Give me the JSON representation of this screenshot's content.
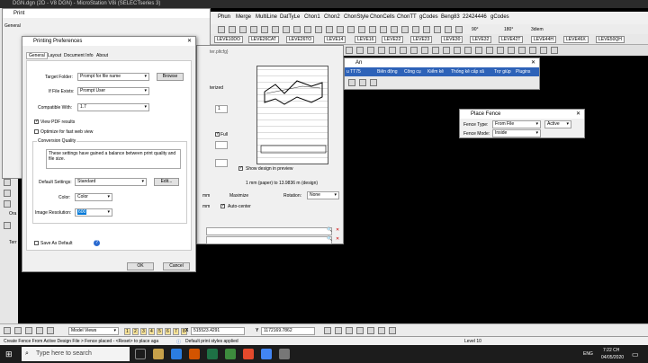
{
  "app": {
    "title": "DGN.dgn (2D - V8 DGN) - MicroStation V8i (SELECTseries 3)"
  },
  "menubar": {
    "items": [
      "Phun",
      "Merge",
      "MultiLine",
      "DatTyLe",
      "Chon1",
      "Chon2",
      "ChonStyle",
      "ChonCells",
      "ChonTT",
      "gCodes",
      "Beng83",
      "22424446",
      "gCodes"
    ]
  },
  "levels": [
    "LEVE10DO",
    "LEVE26CAT",
    "LEVE26TO",
    "LEVE14",
    "LEVE16",
    "LEVE22",
    "LEVE23",
    "LEVE30",
    "LEVE32",
    "LEVE42T",
    "LEVE44H",
    "LEVE46X",
    "LEVE50QH"
  ],
  "toolbar": {
    "zoom": "90°",
    "angle": "180°",
    "stepsize": "3diem"
  },
  "print_window": {
    "title": "Print",
    "tab": "General",
    "scale_text": "1 mm (paper) to 13.9836 m (design)",
    "rotation_label": "Rotation:",
    "rotation_value": "None",
    "maximize_label": "Maximize",
    "autocenter_label": "Auto-center",
    "show_design_label": "Show design in preview",
    "full_label": "Full",
    "mm1": "mm",
    "mm2": "mm",
    "field_value": "1",
    "file_name": "ter.pltcfg}",
    "side_labels": [
      "Ora",
      "Terr"
    ]
  },
  "printing_prefs": {
    "title": "Printing Preferences",
    "tabs": [
      "General",
      "Layout",
      "Document Info",
      "About"
    ],
    "target_folder_label": "Target Folder:",
    "target_folder_value": "Prompt for file name",
    "browse_label": "Browse",
    "if_file_exists_label": "If File Exists:",
    "if_file_exists_value": "Prompt User",
    "compatible_label": "Compatible With:",
    "compatible_value": "1.7",
    "view_pdf_label": "View PDF results",
    "optimize_label": "Optimize for fast web view",
    "conversion_quality_label": "Conversion Quality",
    "conversion_text": "These settings have gained a balance between print quality and file size.",
    "default_settings_label": "Default Settings:",
    "default_settings_value": "Standard",
    "edit_label": "Edit...",
    "color_label": "Color:",
    "color_value": "Color",
    "resolution_label": "Image Resolution:",
    "resolution_value": "600",
    "save_default_label": "Save As Default",
    "help_label": "?",
    "ok_label": "OK",
    "cancel_label": "Cancel"
  },
  "vn_toolbar": {
    "title": "An",
    "items": [
      "u TT75",
      "Biên động",
      "Công cụ",
      "Kiểm kê",
      "Thống kê cấp xã",
      "Trợ giúp",
      "Plugins"
    ]
  },
  "place_fence": {
    "title": "Place Fence",
    "fence_type_label": "Fence Type:",
    "fence_type_value": "From File",
    "active_value": "Active",
    "fence_mode_label": "Fence Mode:",
    "fence_mode_value": "Inside"
  },
  "bottom_toolbar": {
    "view_mode": "Model Views",
    "views": [
      "1",
      "2",
      "3",
      "4",
      "5",
      "6",
      "7",
      "8"
    ],
    "x_label": "X",
    "x_value": "515523.4291",
    "y_label": "Y",
    "y_value": "1172169.7862"
  },
  "status": {
    "left": "Create Fence From Active Design File > Fence placed - <Reset> to place aga",
    "middle": "Default print styles applied",
    "level": "Level 10"
  },
  "taskbar": {
    "search": "Type here to search",
    "lang": "ENG",
    "time": "7:22 CH",
    "date": "04/05/2020"
  },
  "colors": {
    "accent": "#0078d7",
    "canvas": "#000000"
  }
}
